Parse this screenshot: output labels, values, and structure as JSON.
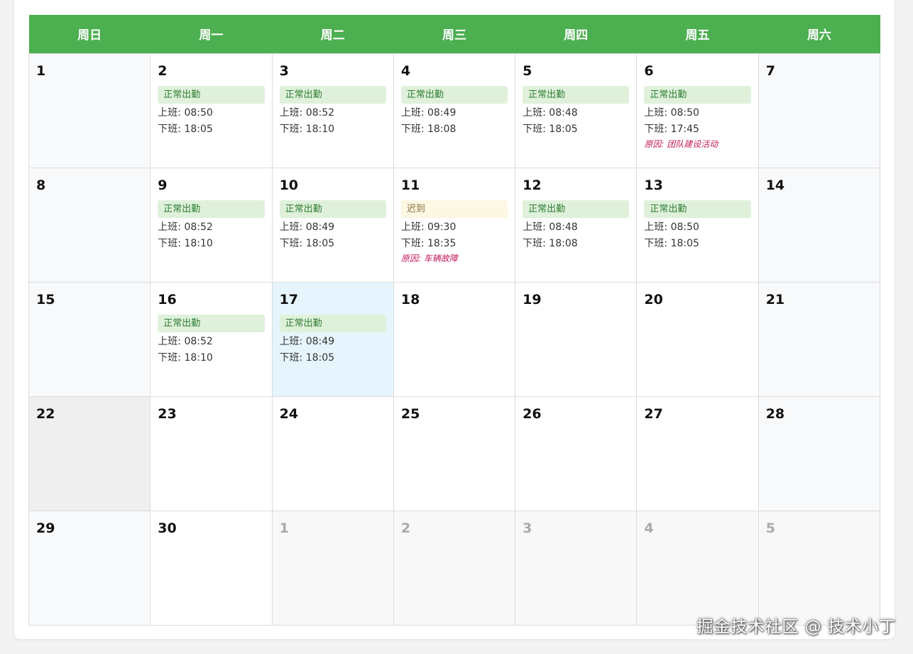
{
  "weekdays": [
    "周日",
    "周一",
    "周二",
    "周三",
    "周四",
    "周五",
    "周六"
  ],
  "labels": {
    "checkin": "上班: ",
    "checkout": "下班: ",
    "reason": "原因: "
  },
  "weeks": [
    [
      {
        "day": "1",
        "kind": "weekend"
      },
      {
        "day": "2",
        "kind": "normal",
        "status": "正常出勤",
        "status_type": "normal",
        "in": "08:50",
        "out": "18:05"
      },
      {
        "day": "3",
        "kind": "normal",
        "status": "正常出勤",
        "status_type": "normal",
        "in": "08:52",
        "out": "18:10"
      },
      {
        "day": "4",
        "kind": "normal",
        "status": "正常出勤",
        "status_type": "normal",
        "in": "08:49",
        "out": "18:08"
      },
      {
        "day": "5",
        "kind": "normal",
        "status": "正常出勤",
        "status_type": "normal",
        "in": "08:48",
        "out": "18:05"
      },
      {
        "day": "6",
        "kind": "normal",
        "status": "正常出勤",
        "status_type": "normal",
        "in": "08:50",
        "out": "17:45",
        "reason": "团队建设活动"
      },
      {
        "day": "7",
        "kind": "weekend"
      }
    ],
    [
      {
        "day": "8",
        "kind": "weekend"
      },
      {
        "day": "9",
        "kind": "normal",
        "status": "正常出勤",
        "status_type": "normal",
        "in": "08:52",
        "out": "18:10"
      },
      {
        "day": "10",
        "kind": "normal",
        "status": "正常出勤",
        "status_type": "normal",
        "in": "08:49",
        "out": "18:05"
      },
      {
        "day": "11",
        "kind": "normal",
        "status": "迟到",
        "status_type": "late",
        "in": "09:30",
        "out": "18:35",
        "reason": "车辆故障"
      },
      {
        "day": "12",
        "kind": "normal",
        "status": "正常出勤",
        "status_type": "normal",
        "in": "08:48",
        "out": "18:08"
      },
      {
        "day": "13",
        "kind": "normal",
        "status": "正常出勤",
        "status_type": "normal",
        "in": "08:50",
        "out": "18:05"
      },
      {
        "day": "14",
        "kind": "weekend"
      }
    ],
    [
      {
        "day": "15",
        "kind": "weekend"
      },
      {
        "day": "16",
        "kind": "normal",
        "status": "正常出勤",
        "status_type": "normal",
        "in": "08:52",
        "out": "18:10"
      },
      {
        "day": "17",
        "kind": "today",
        "status": "正常出勤",
        "status_type": "normal",
        "in": "08:49",
        "out": "18:05"
      },
      {
        "day": "18",
        "kind": "normal"
      },
      {
        "day": "19",
        "kind": "normal"
      },
      {
        "day": "20",
        "kind": "normal"
      },
      {
        "day": "21",
        "kind": "weekend"
      }
    ],
    [
      {
        "day": "22",
        "kind": "selected"
      },
      {
        "day": "23",
        "kind": "normal"
      },
      {
        "day": "24",
        "kind": "normal"
      },
      {
        "day": "25",
        "kind": "normal"
      },
      {
        "day": "26",
        "kind": "normal"
      },
      {
        "day": "27",
        "kind": "normal"
      },
      {
        "day": "28",
        "kind": "weekend"
      }
    ],
    [
      {
        "day": "29",
        "kind": "weekend"
      },
      {
        "day": "30",
        "kind": "normal"
      },
      {
        "day": "1",
        "kind": "other"
      },
      {
        "day": "2",
        "kind": "other"
      },
      {
        "day": "3",
        "kind": "other"
      },
      {
        "day": "4",
        "kind": "other"
      },
      {
        "day": "5",
        "kind": "other"
      }
    ]
  ],
  "colors": {
    "header": "#4caf50",
    "normal_badge": "#dff1db",
    "late_badge": "#fcf8e3",
    "today": "#e6f4fd",
    "reason": "#c2185b"
  },
  "watermark": "掘金技术社区 @ 技术小丁"
}
